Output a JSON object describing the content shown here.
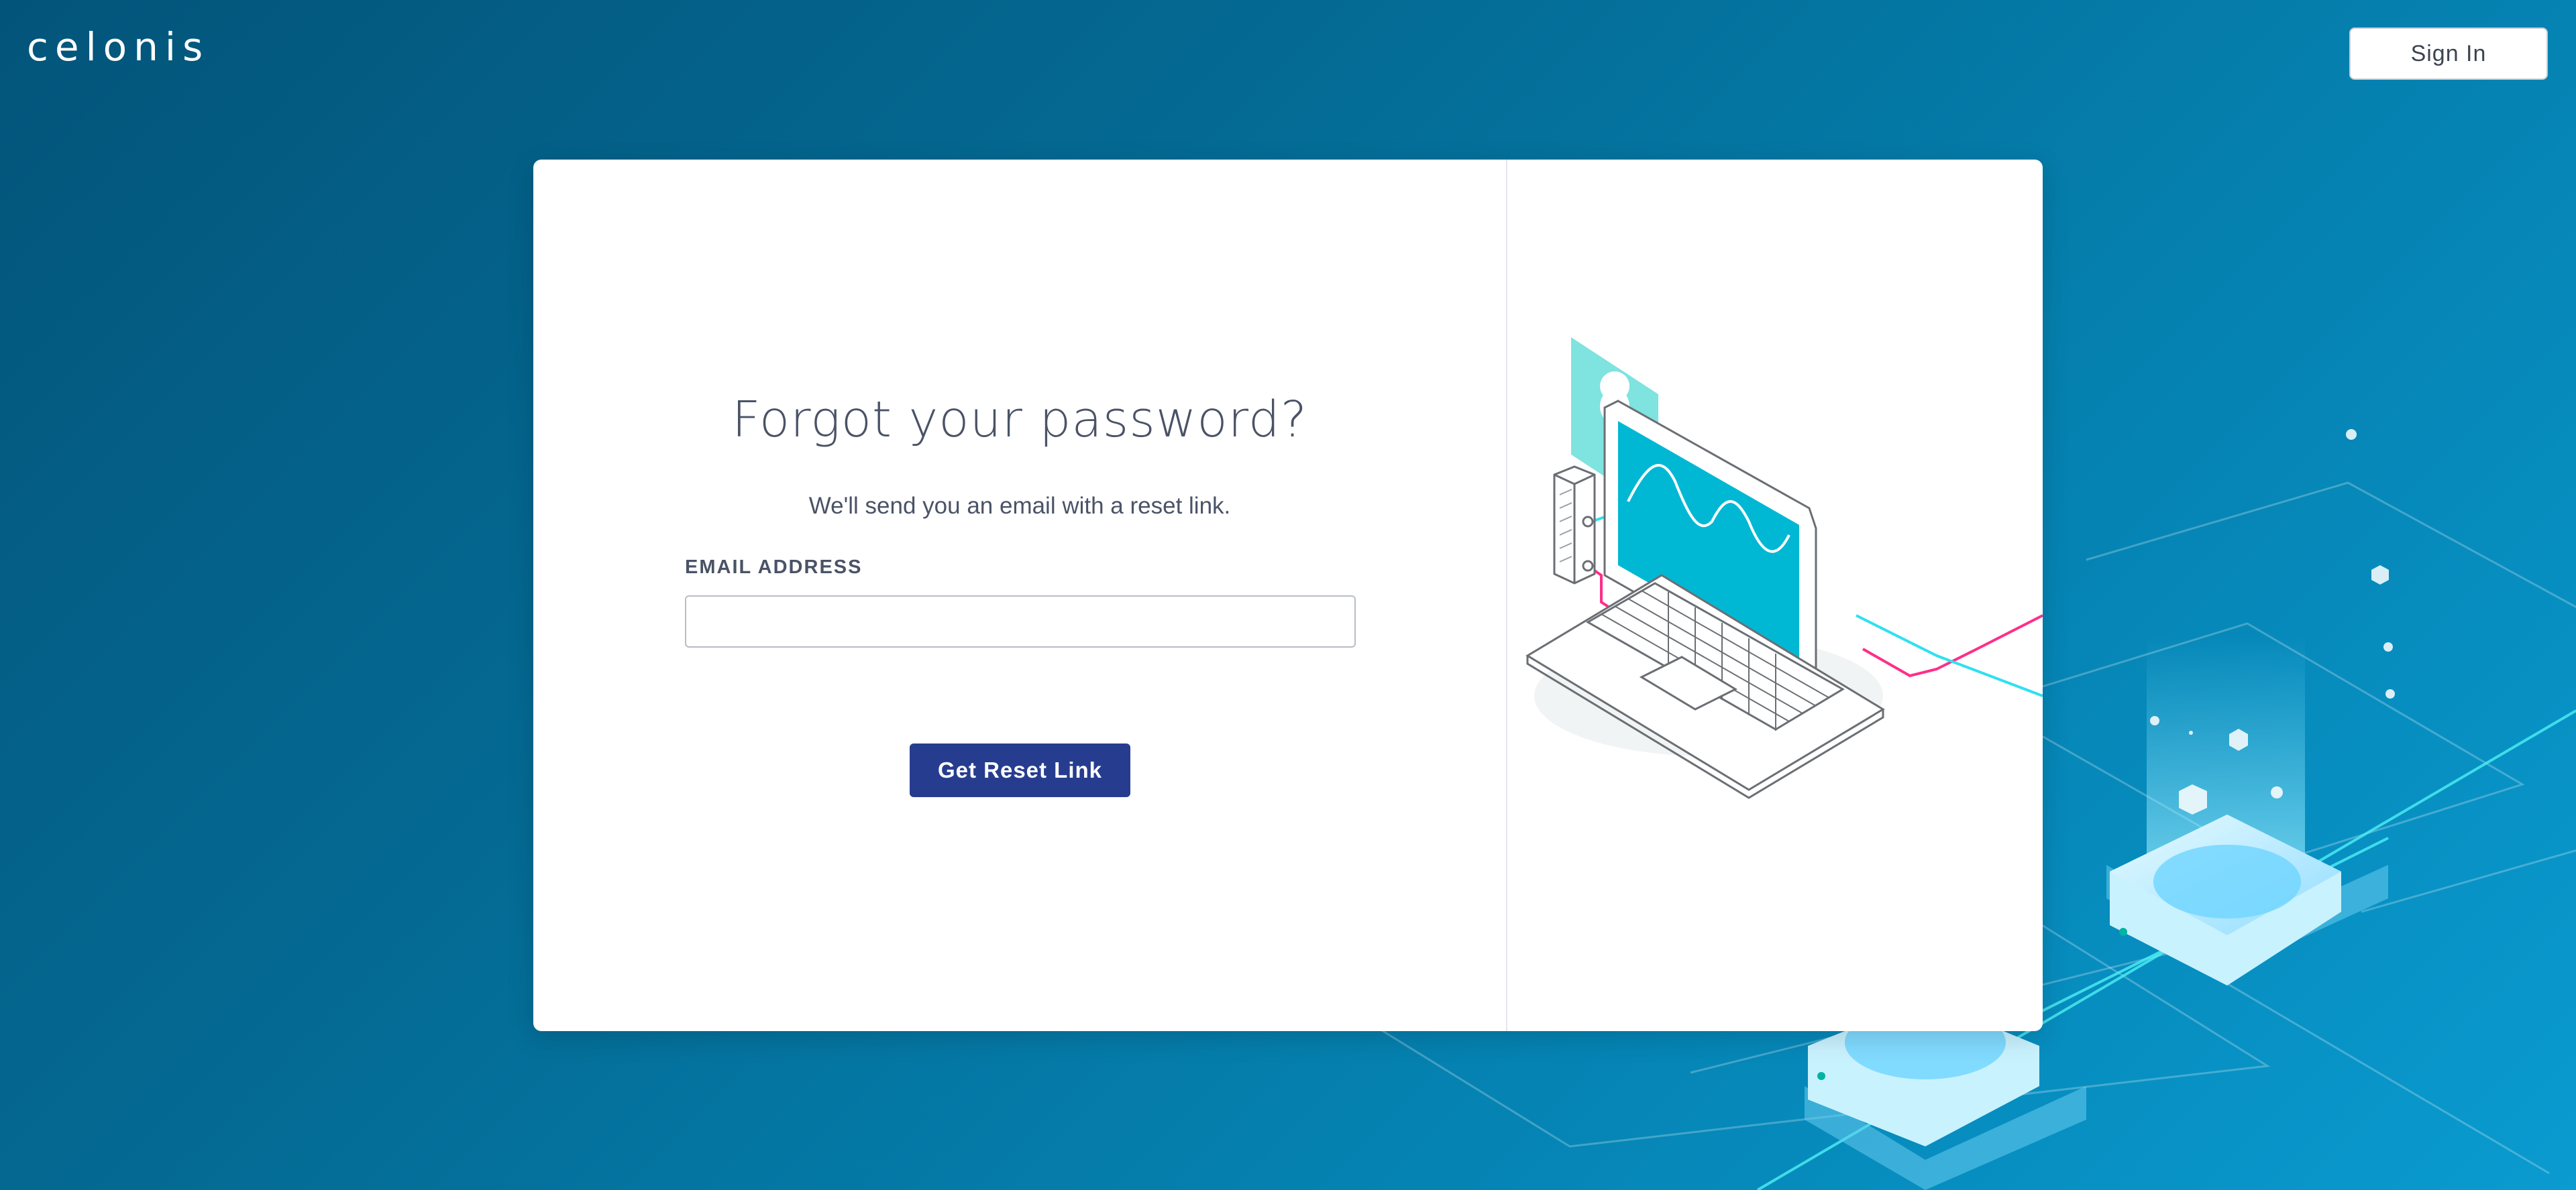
{
  "header": {
    "logo_text": "celonis",
    "signin_label": "Sign In"
  },
  "form": {
    "title": "Forgot your password?",
    "subtitle": "We'll send you an email with a reset link.",
    "email_label": "EMAIL ADDRESS",
    "email_value": "",
    "email_placeholder": "",
    "submit_label": "Get Reset Link"
  },
  "colors": {
    "background_start": "#03547a",
    "background_end": "#0a9bd0",
    "primary_button": "#263d8f",
    "card": "#ffffff",
    "accent_cyan": "#00c2e0",
    "accent_pink": "#ff2e8a"
  },
  "icons": {
    "illustration": "laptop-with-lock-illustration",
    "background_art": "isometric-server-platforms"
  }
}
